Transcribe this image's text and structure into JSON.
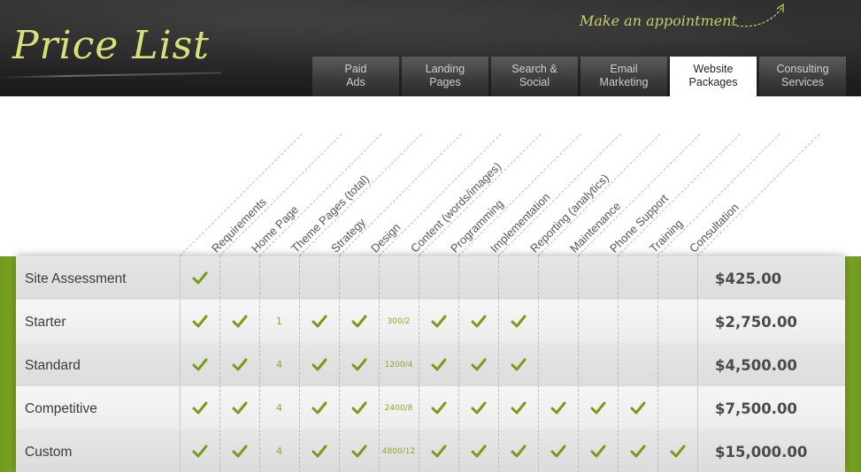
{
  "header": {
    "logo": "Price List",
    "appointment": "Make an appointment"
  },
  "tabs": [
    {
      "line1": "Paid",
      "line2": "Ads",
      "active": false
    },
    {
      "line1": "Landing",
      "line2": "Pages",
      "active": false
    },
    {
      "line1": "Search &",
      "line2": "Social",
      "active": false
    },
    {
      "line1": "Email",
      "line2": "Marketing",
      "active": false
    },
    {
      "line1": "Website",
      "line2": "Packages",
      "active": true
    },
    {
      "line1": "Consulting",
      "line2": "Services",
      "active": false
    }
  ],
  "columns": [
    "Requirements",
    "Home Page",
    "Theme Pages (total)",
    "Strategy",
    "Design",
    "Content (words/images)",
    "Programming",
    "Implementation",
    "Reporting (analytics)",
    "Maintenance",
    "Phone Support",
    "Training",
    "Consultation"
  ],
  "rows": [
    {
      "name": "Site Assessment",
      "price": "$425.00",
      "cells": [
        "check",
        "",
        "",
        "",
        "",
        "",
        "",
        "",
        "",
        "",
        "",
        "",
        ""
      ]
    },
    {
      "name": "Starter",
      "price": "$2,750.00",
      "cells": [
        "check",
        "check",
        "1",
        "check",
        "check",
        "300/2",
        "check",
        "check",
        "check",
        "",
        "",
        "",
        ""
      ]
    },
    {
      "name": "Standard",
      "price": "$4,500.00",
      "cells": [
        "check",
        "check",
        "4",
        "check",
        "check",
        "1200/4",
        "check",
        "check",
        "check",
        "",
        "",
        "",
        ""
      ]
    },
    {
      "name": "Competitive",
      "price": "$7,500.00",
      "cells": [
        "check",
        "check",
        "4",
        "check",
        "check",
        "2400/8",
        "check",
        "check",
        "check",
        "check",
        "check",
        "check",
        ""
      ]
    },
    {
      "name": "Custom",
      "price": "$15,000.00",
      "cells": [
        "check",
        "check",
        "4",
        "check",
        "check",
        "4800/12",
        "check",
        "check",
        "check",
        "check",
        "check",
        "check",
        "check"
      ]
    }
  ],
  "colors": {
    "accent_green": "#a3c83f",
    "check_green": "#7a9a1a",
    "chalk_yellow": "#d8e07a"
  },
  "icons": {
    "check": "check-icon",
    "arrow": "curved-arrow-icon"
  }
}
